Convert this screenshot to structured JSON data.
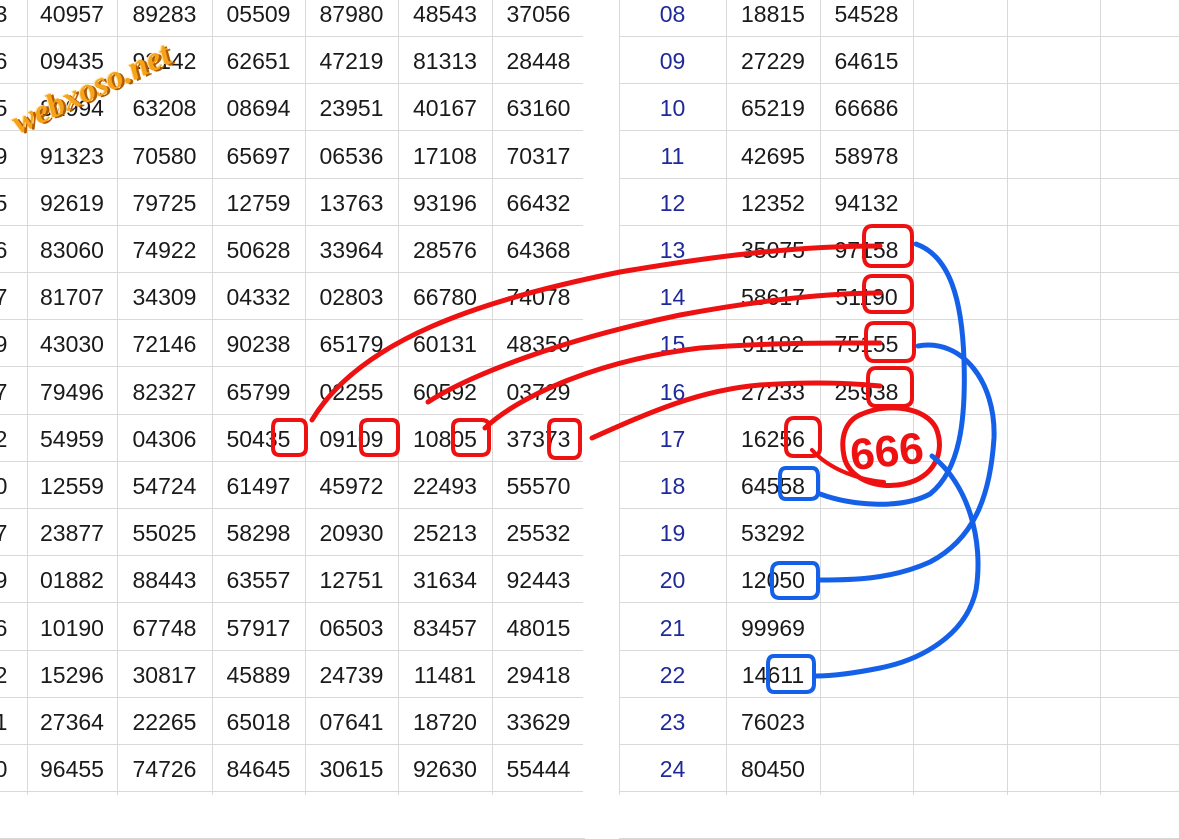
{
  "left_table": {
    "row_labels": [
      "3",
      "6",
      "5",
      "9",
      "5",
      "6",
      "7",
      "9",
      "7",
      "2",
      "0",
      "7",
      "9",
      "6",
      "2",
      "1",
      "0"
    ],
    "rows": [
      [
        "40957",
        "89283",
        "05509",
        "87980",
        "48543",
        "37056"
      ],
      [
        "09435",
        "92142",
        "62651",
        "47219",
        "81313",
        "28448"
      ],
      [
        "81994",
        "63208",
        "08694",
        "23951",
        "40167",
        "63160"
      ],
      [
        "91323",
        "70580",
        "65697",
        "06536",
        "17108",
        "70317"
      ],
      [
        "92619",
        "79725",
        "12759",
        "13763",
        "93196",
        "66432"
      ],
      [
        "83060",
        "74922",
        "50628",
        "33964",
        "28576",
        "64368"
      ],
      [
        "81707",
        "34309",
        "04332",
        "02803",
        "66780",
        "74078"
      ],
      [
        "43030",
        "72146",
        "90238",
        "65179",
        "60131",
        "48350"
      ],
      [
        "79496",
        "82327",
        "65799",
        "02255",
        "60592",
        "03729"
      ],
      [
        "54959",
        "04306",
        "50435",
        "09109",
        "10805",
        "37373"
      ],
      [
        "12559",
        "54724",
        "61497",
        "45972",
        "22493",
        "55570"
      ],
      [
        "23877",
        "55025",
        "58298",
        "20930",
        "25213",
        "25532"
      ],
      [
        "01882",
        "88443",
        "63557",
        "12751",
        "31634",
        "92443"
      ],
      [
        "10190",
        "67748",
        "57917",
        "06503",
        "83457",
        "48015"
      ],
      [
        "15296",
        "30817",
        "45889",
        "24739",
        "11481",
        "29418"
      ],
      [
        "27364",
        "22265",
        "65018",
        "07641",
        "18720",
        "33629"
      ],
      [
        "96455",
        "74726",
        "84645",
        "30615",
        "92630",
        "55444"
      ]
    ]
  },
  "right_table": {
    "rows": [
      {
        "day": "08",
        "a": "18815",
        "b": "54528"
      },
      {
        "day": "09",
        "a": "27229",
        "b": "64615"
      },
      {
        "day": "10",
        "a": "65219",
        "b": "66686"
      },
      {
        "day": "11",
        "a": "42695",
        "b": "58978"
      },
      {
        "day": "12",
        "a": "12352",
        "b": "94132"
      },
      {
        "day": "13",
        "a": "35075",
        "b": "97158"
      },
      {
        "day": "14",
        "a": "58617",
        "b": "51190"
      },
      {
        "day": "15",
        "a": "91182",
        "b": "75155"
      },
      {
        "day": "16",
        "a": "27233",
        "b": "25938"
      },
      {
        "day": "17",
        "a": "16256",
        "b": ""
      },
      {
        "day": "18",
        "a": "64558",
        "b": ""
      },
      {
        "day": "19",
        "a": "53292",
        "b": ""
      },
      {
        "day": "20",
        "a": "12050",
        "b": ""
      },
      {
        "day": "21",
        "a": "99969",
        "b": ""
      },
      {
        "day": "22",
        "a": "14611",
        "b": ""
      },
      {
        "day": "23",
        "a": "76023",
        "b": ""
      },
      {
        "day": "24",
        "a": "80450",
        "b": ""
      }
    ]
  },
  "annotation": {
    "handwritten_note": "666",
    "red_color": "#ee1111",
    "blue_color": "#1560e8"
  },
  "watermark": "webxoso.net"
}
